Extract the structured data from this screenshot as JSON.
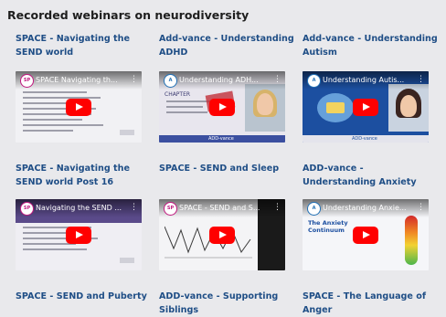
{
  "page": {
    "title": "Recorded webinars on neurodiversity"
  },
  "videos": [
    {
      "title": "SPACE - Navigating the SEND world",
      "thumb_title": "SPACE Navigating th...",
      "logo": "space"
    },
    {
      "title": "Add-vance - Understanding ADHD",
      "thumb_title": "Understanding ADH...",
      "logo": "add"
    },
    {
      "title": "Add-vance - Understanding Autism",
      "thumb_title": "Understanding Autis...",
      "logo": "add"
    },
    {
      "title": "SPACE - Navigating the SEND world Post 16",
      "thumb_title": "Navigating the SEND ...",
      "logo": "space"
    },
    {
      "title": "SPACE - SEND and Sleep",
      "thumb_title": "SPACE - SEND and S...",
      "logo": "space"
    },
    {
      "title": "ADD-vance - Understanding Anxiety",
      "thumb_title": "Understanding Anxie...",
      "logo": "add"
    },
    {
      "title": "SPACE - SEND and Puberty"
    },
    {
      "title": "ADD-vance - Supporting Siblings"
    },
    {
      "title": "SPACE - The Language of Anger"
    }
  ],
  "thumb_text": {
    "chapter": "CHAPTER",
    "add_vance": "ADD-vance",
    "anxiety_line1": "The Anxiety",
    "anxiety_line2": "Continuum",
    "logo_space": "SP",
    "logo_add": "A",
    "menu": "⋮"
  },
  "colors": {
    "background": "#e9e9ec",
    "link": "#1f4e86",
    "youtube_red": "#ff0000",
    "space_brand": "#c0177e",
    "add_brand": "#1f6fb5"
  }
}
